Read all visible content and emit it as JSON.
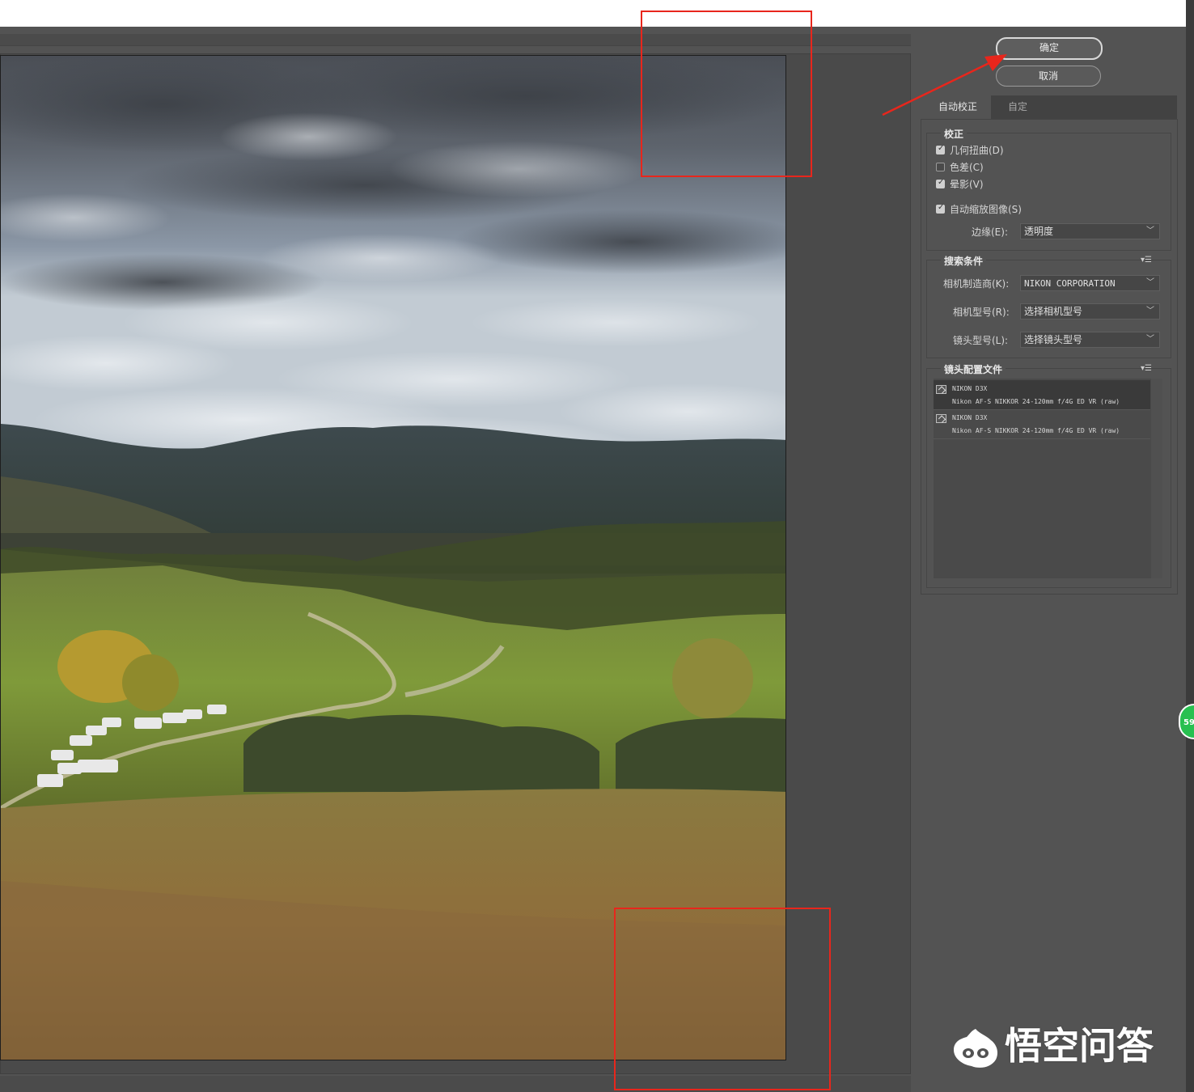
{
  "buttons": {
    "ok": "确定",
    "cancel": "取消"
  },
  "tabs": [
    {
      "label": "自动校正",
      "active": true
    },
    {
      "label": "自定",
      "active": false
    }
  ],
  "correction": {
    "title": "校正",
    "geometric": {
      "label": "几何扭曲(D)",
      "checked": true
    },
    "chromatic": {
      "label": "色差(C)",
      "checked": false
    },
    "vignette": {
      "label": "晕影(V)",
      "checked": true
    },
    "autoscale": {
      "label": "自动缩放图像(S)",
      "checked": true
    },
    "edge": {
      "label": "边缘(E):",
      "value": "透明度"
    }
  },
  "search": {
    "title": "搜索条件",
    "maker": {
      "label": "相机制造商(K):",
      "value": "NIKON CORPORATION"
    },
    "model": {
      "label": "相机型号(R):",
      "value": "选择相机型号"
    },
    "lens": {
      "label": "镜头型号(L):",
      "value": "选择镜头型号"
    }
  },
  "profiles": {
    "title": "镜头配置文件",
    "items": [
      {
        "camera": "NIKON D3X",
        "lens": "Nikon AF-S NIKKOR 24-120mm f/4G ED VR (raw)"
      },
      {
        "camera": "NIKON D3X",
        "lens": "Nikon AF-S NIKKOR 24-120mm f/4G ED VR (raw)"
      }
    ]
  },
  "badge": "59",
  "watermark": "悟空问答",
  "colors": {
    "annotation_red": "#e8261c",
    "panel_bg": "#535353",
    "badge_green": "#28c050"
  },
  "icons": {
    "dropdown": "chevron-down-icon",
    "menu": "panel-menu-icon",
    "profile": "lens-profile-icon",
    "logo": "wukong-logo-icon"
  }
}
